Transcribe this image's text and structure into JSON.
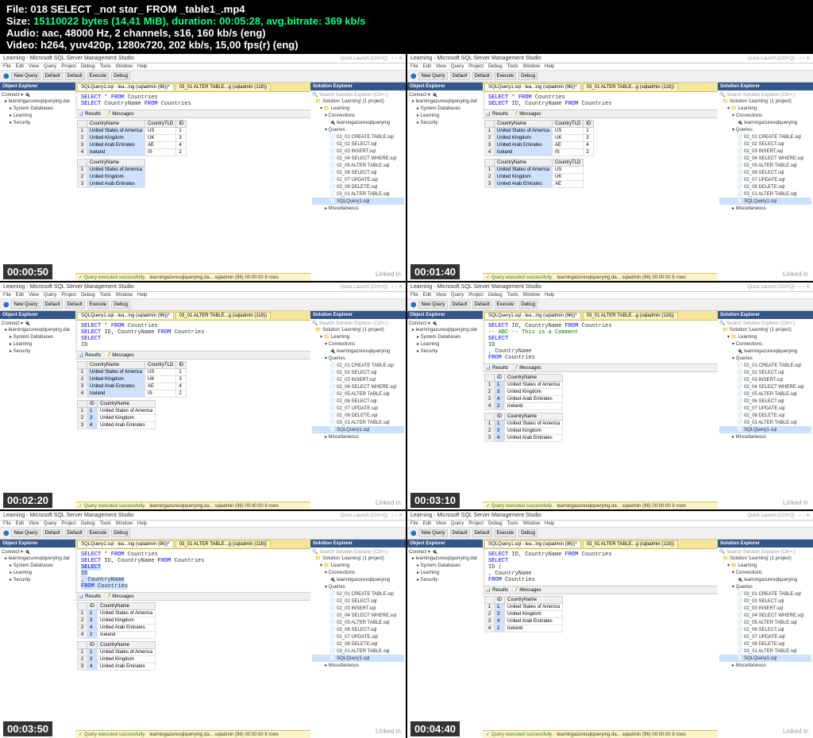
{
  "fileinfo": {
    "file_label": "File: ",
    "filename": "018 SELECT _not star_ FROM _table1_.mp4",
    "size_label": "Size: ",
    "size": "15110022 bytes (14,41 MiB), duration: 00:05:28, avg.bitrate: 369 kb/s",
    "audio_label": "Audio: ",
    "audio": "aac, 48000 Hz, 2 channels, s16, 160 kb/s (eng)",
    "video_label": "Video: ",
    "video": "h264, yuv420p, 1280x720, 202 kb/s, 15,00 fps(r) (eng)"
  },
  "common": {
    "app_title": "Learning - Microsoft SQL Server Management Studio",
    "quick_launch": "Quick Launch (Ctrl+Q)",
    "menus": [
      "File",
      "Edit",
      "View",
      "Query",
      "Project",
      "Debug",
      "Tools",
      "Window",
      "Help"
    ],
    "toolbar_items": [
      "New Query",
      "Default",
      "Default",
      "Execute",
      "Debug"
    ],
    "object_explorer": "Object Explorer",
    "solution_explorer": "Solution Explorer",
    "connect": "Connect ▾",
    "results_label": "Results",
    "messages_label": "Messages",
    "status_ok": "✓ Query executed successfully.",
    "status_right": "learningazuresqlquerying.da...  sqladmin (96)  00:00:00  8 rows",
    "search_placeholder": "Search Solution Explorer (Ctrl+;)",
    "tree_db": "learningazuresqlquerying.database.windows.net",
    "tree_items": [
      "System Databases",
      "Learning",
      "Security"
    ],
    "solution_root": "Solution 'Learning' (1 project)",
    "solution_project": "Learning",
    "solution_connections": "Connections",
    "solution_conn1": "learningazuresqlquerying.database.windows.net",
    "solution_queries": "Queries",
    "solution_files": [
      "02_01 CREATE TABLE.sql",
      "02_02 SELECT.sql",
      "02_03 INSERT.sql",
      "02_04 SELECT WHERE.sql",
      "02_05 ALTER TABLE.sql",
      "02_06 SELECT.sql",
      "02_07 UPDATE.sql",
      "02_08 DELETE.sql",
      "03_01 ALTER TABLE.sql",
      "SQLQuery1.sql"
    ],
    "solution_misc": "Miscellaneous",
    "tabs": [
      "SQLQuery1.sql - lea...ing (sqladmin (96))*",
      "03_01 ALTER TABLE...g (sqladmin (118))"
    ],
    "watermark": "Linked in"
  },
  "frames": [
    {
      "timestamp": "00:00:50",
      "query_lines": [
        [
          {
            "t": "SELECT",
            "c": "kw"
          },
          {
            "t": " * "
          },
          {
            "t": "FROM",
            "c": "kw"
          },
          {
            "t": " Countries"
          }
        ],
        [
          {
            "t": " "
          }
        ],
        [
          {
            "t": "SELECT",
            "c": "kw"
          },
          {
            "t": " CountryName "
          },
          {
            "t": "FROM",
            "c": "kw"
          },
          {
            "t": " Countries"
          }
        ]
      ],
      "results": [
        {
          "headers": [
            "",
            "CountryName",
            "CountryTLD",
            "ID"
          ],
          "rows": [
            [
              "1",
              "United States of America",
              "US",
              "1"
            ],
            [
              "2",
              "United Kingdom",
              "UK",
              "3"
            ],
            [
              "3",
              "United Arab Emirates",
              "AE",
              "4"
            ],
            [
              "4",
              "Iceland",
              "IS",
              "2"
            ]
          ]
        },
        {
          "headers": [
            "",
            "CountryName"
          ],
          "rows": [
            [
              "1",
              "United States of America"
            ],
            [
              "2",
              "United Kingdom"
            ],
            [
              "3",
              "United Arab Emirates"
            ]
          ]
        }
      ]
    },
    {
      "timestamp": "00:01:40",
      "query_lines": [
        [
          {
            "t": "SELECT",
            "c": "kw"
          },
          {
            "t": " * "
          },
          {
            "t": "FROM",
            "c": "kw"
          },
          {
            "t": " Countries"
          }
        ],
        [
          {
            "t": " "
          }
        ],
        [
          {
            "t": "SELECT",
            "c": "kw"
          },
          {
            "t": " ID, CountryName "
          },
          {
            "t": "FROM",
            "c": "kw"
          },
          {
            "t": " Countries"
          }
        ]
      ],
      "results": [
        {
          "headers": [
            "",
            "CountryName",
            "CountryTLD",
            "ID"
          ],
          "rows": [
            [
              "1",
              "United States of America",
              "US",
              "1"
            ],
            [
              "2",
              "United Kingdom",
              "UK",
              "3"
            ],
            [
              "3",
              "United Arab Emirates",
              "AE",
              "4"
            ],
            [
              "4",
              "Iceland",
              "IS",
              "2"
            ]
          ]
        },
        {
          "headers": [
            "",
            "CountryName",
            "CountryTLD"
          ],
          "rows": [
            [
              "1",
              "United States of America",
              "US"
            ],
            [
              "2",
              "United Kingdom",
              "UK"
            ],
            [
              "3",
              "United Arab Emirates",
              "AE"
            ]
          ]
        }
      ]
    },
    {
      "timestamp": "00:02:20",
      "query_lines": [
        [
          {
            "t": "SELECT",
            "c": "kw"
          },
          {
            "t": " * "
          },
          {
            "t": "FROM",
            "c": "kw"
          },
          {
            "t": " Countries"
          }
        ],
        [
          {
            "t": " "
          }
        ],
        [
          {
            "t": "SELECT",
            "c": "kw"
          },
          {
            "t": " ID, CountryName "
          },
          {
            "t": "FROM",
            "c": "kw"
          },
          {
            "t": " Countries"
          }
        ],
        [
          {
            "t": " "
          }
        ],
        [
          {
            "t": "SELECT",
            "c": "kw"
          }
        ],
        [
          {
            "t": "        ID"
          }
        ]
      ],
      "results": [
        {
          "headers": [
            "",
            "CountryName",
            "CountryTLD",
            "ID"
          ],
          "rows": [
            [
              "1",
              "United States of America",
              "US",
              "1"
            ],
            [
              "2",
              "United Kingdom",
              "UK",
              "3"
            ],
            [
              "3",
              "United Arab Emirates",
              "AE",
              "4"
            ],
            [
              "4",
              "Iceland",
              "IS",
              "2"
            ]
          ]
        },
        {
          "headers": [
            "",
            "ID",
            "CountryName"
          ],
          "rows": [
            [
              "1",
              "1",
              "United States of America"
            ],
            [
              "2",
              "3",
              "United Kingdom"
            ],
            [
              "3",
              "4",
              "United Arab Emirates"
            ]
          ]
        }
      ]
    },
    {
      "timestamp": "00:03:10",
      "query_lines": [
        [
          {
            "t": "SELECT",
            "c": "kw"
          },
          {
            "t": " ID, CountryName "
          },
          {
            "t": "FROM",
            "c": "kw"
          },
          {
            "t": " Countries"
          }
        ],
        [
          {
            "t": "-- ABC -- This is a Comment",
            "c": "comment"
          }
        ],
        [
          {
            "t": "SELECT",
            "c": "kw"
          }
        ],
        [
          {
            "t": "        ID"
          }
        ],
        [
          {
            "t": "      , CountryName"
          }
        ],
        [
          {
            "t": "FROM",
            "c": "kw"
          },
          {
            "t": " Countries"
          }
        ]
      ],
      "results": [
        {
          "headers": [
            "",
            "ID",
            "CountryName"
          ],
          "rows": [
            [
              "1",
              "1",
              "United States of America"
            ],
            [
              "2",
              "3",
              "United Kingdom"
            ],
            [
              "3",
              "4",
              "United Arab Emirates"
            ],
            [
              "4",
              "2",
              "Iceland"
            ]
          ]
        },
        {
          "headers": [
            "",
            "ID",
            "CountryName"
          ],
          "rows": [
            [
              "1",
              "1",
              "United States of America"
            ],
            [
              "2",
              "3",
              "United Kingdom"
            ],
            [
              "3",
              "4",
              "United Arab Emirates"
            ]
          ]
        }
      ]
    },
    {
      "timestamp": "00:03:50",
      "query_lines": [
        [
          {
            "t": "SELECT",
            "c": "kw"
          },
          {
            "t": " * "
          },
          {
            "t": "FROM",
            "c": "kw"
          },
          {
            "t": " Countries"
          }
        ],
        [
          {
            "t": " "
          }
        ],
        [
          {
            "t": "SELECT",
            "c": "kw"
          },
          {
            "t": " ID, CountryName "
          },
          {
            "t": "FROM",
            "c": "kw"
          },
          {
            "t": " Countries"
          }
        ],
        [
          {
            "t": " "
          }
        ],
        [
          {
            "t": "SELECT",
            "c": "kw highlight-sel"
          }
        ],
        [
          {
            "t": "        ID",
            "c": "highlight-sel"
          }
        ],
        [
          {
            "t": "      , CountryName",
            "c": "highlight-sel"
          }
        ],
        [
          {
            "t": "FROM",
            "c": "kw highlight-sel"
          },
          {
            "t": " Countries",
            "c": "highlight-sel"
          }
        ]
      ],
      "results": [
        {
          "headers": [
            "",
            "ID",
            "CountryName"
          ],
          "rows": [
            [
              "1",
              "1",
              "United States of America"
            ],
            [
              "2",
              "3",
              "United Kingdom"
            ],
            [
              "3",
              "4",
              "United Arab Emirates"
            ],
            [
              "4",
              "2",
              "Iceland"
            ]
          ]
        },
        {
          "headers": [
            "",
            "ID",
            "CountryName"
          ],
          "rows": [
            [
              "1",
              "1",
              "United States of America"
            ],
            [
              "2",
              "3",
              "United Kingdom"
            ],
            [
              "3",
              "4",
              "United Arab Emirates"
            ]
          ]
        }
      ]
    },
    {
      "timestamp": "00:04:40",
      "query_lines": [
        [
          {
            "t": "SELECT",
            "c": "kw"
          },
          {
            "t": " ID, CountryName "
          },
          {
            "t": "FROM",
            "c": "kw"
          },
          {
            "t": " Countries"
          }
        ],
        [
          {
            "t": " "
          }
        ],
        [
          {
            "t": "SELECT",
            "c": "kw"
          }
        ],
        [
          {
            "t": "        ID           |"
          }
        ],
        [
          {
            "t": "      , CountryName"
          }
        ],
        [
          {
            "t": "FROM",
            "c": "kw"
          },
          {
            "t": " Countries"
          }
        ]
      ],
      "results": [
        {
          "headers": [
            "",
            "ID",
            "CountryName"
          ],
          "rows": [
            [
              "1",
              "1",
              "United States of America"
            ],
            [
              "2",
              "3",
              "United Kingdom"
            ],
            [
              "3",
              "4",
              "United Arab Emirates"
            ],
            [
              "4",
              "2",
              "Iceland"
            ]
          ]
        }
      ]
    }
  ]
}
